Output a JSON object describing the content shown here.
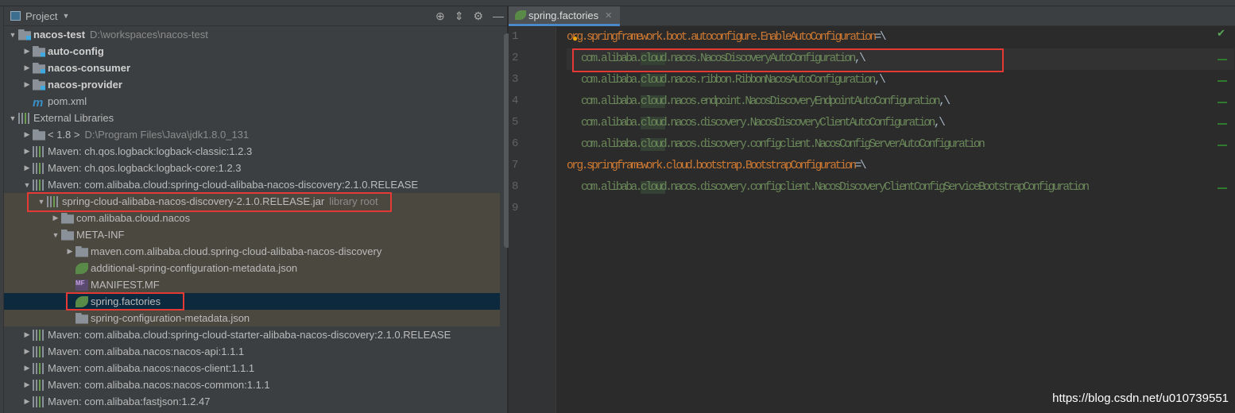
{
  "project_panel": {
    "title": "Project",
    "tree": [
      {
        "label": "nacos-test",
        "hint": "D:\\workspaces\\nacos-test",
        "depth": 0,
        "arrow": "down",
        "icon": "module-folder",
        "bold": true
      },
      {
        "label": "auto-config",
        "depth": 1,
        "arrow": "right",
        "icon": "module-folder",
        "bold": true
      },
      {
        "label": "nacos-consumer",
        "depth": 1,
        "arrow": "right",
        "icon": "module-folder",
        "bold": true
      },
      {
        "label": "nacos-provider",
        "depth": 1,
        "arrow": "right",
        "icon": "module-folder",
        "bold": true
      },
      {
        "label": "pom.xml",
        "depth": 1,
        "arrow": "",
        "icon": "maven-file"
      },
      {
        "label": "External Libraries",
        "depth": 0,
        "arrow": "down",
        "icon": "library"
      },
      {
        "label": "< 1.8 >",
        "hint": "D:\\Program Files\\Java\\jdk1.8.0_131",
        "depth": 1,
        "arrow": "right",
        "icon": "jdk-folder"
      },
      {
        "label": "Maven: ch.qos.logback:logback-classic:1.2.3",
        "depth": 1,
        "arrow": "right",
        "icon": "library"
      },
      {
        "label": "Maven: ch.qos.logback:logback-core:1.2.3",
        "depth": 1,
        "arrow": "right",
        "icon": "library"
      },
      {
        "label": "Maven: com.alibaba.cloud:spring-cloud-alibaba-nacos-discovery:2.1.0.RELEASE",
        "depth": 1,
        "arrow": "down",
        "icon": "library"
      },
      {
        "label": "spring-cloud-alibaba-nacos-discovery-2.1.0.RELEASE.jar",
        "hint": "library root",
        "depth": 2,
        "arrow": "down",
        "icon": "jar",
        "hl": true
      },
      {
        "label": "com.alibaba.cloud.nacos",
        "depth": 3,
        "arrow": "right",
        "icon": "package",
        "hl": true
      },
      {
        "label": "META-INF",
        "depth": 3,
        "arrow": "down",
        "icon": "package",
        "hl": true
      },
      {
        "label": "maven.com.alibaba.cloud.spring-cloud-alibaba-nacos-discovery",
        "depth": 4,
        "arrow": "right",
        "icon": "package",
        "hl": true
      },
      {
        "label": "additional-spring-configuration-metadata.json",
        "depth": 4,
        "arrow": "",
        "icon": "spring-json",
        "hl": true
      },
      {
        "label": "MANIFEST.MF",
        "depth": 4,
        "arrow": "",
        "icon": "manifest",
        "hl": true
      },
      {
        "label": "spring.factories",
        "depth": 4,
        "arrow": "",
        "icon": "spring-leaf",
        "selected": true
      },
      {
        "label": "spring-configuration-metadata.json",
        "depth": 4,
        "arrow": "",
        "icon": "json",
        "hl": true
      },
      {
        "label": "Maven: com.alibaba.cloud:spring-cloud-starter-alibaba-nacos-discovery:2.1.0.RELEASE",
        "depth": 1,
        "arrow": "right",
        "icon": "library"
      },
      {
        "label": "Maven: com.alibaba.nacos:nacos-api:1.1.1",
        "depth": 1,
        "arrow": "right",
        "icon": "library"
      },
      {
        "label": "Maven: com.alibaba.nacos:nacos-client:1.1.1",
        "depth": 1,
        "arrow": "right",
        "icon": "library"
      },
      {
        "label": "Maven: com.alibaba.nacos:nacos-common:1.1.1",
        "depth": 1,
        "arrow": "right",
        "icon": "library"
      },
      {
        "label": "Maven: com.alibaba:fastjson:1.2.47",
        "depth": 1,
        "arrow": "right",
        "icon": "library"
      }
    ]
  },
  "editor": {
    "tab": "spring.factories",
    "lines": [
      {
        "n": "1",
        "kind": "key",
        "text": "org.springframework.boot.autoconfigure.EnableAutoConfiguration",
        "suffix": "=\\"
      },
      {
        "n": "2",
        "kind": "value",
        "text": "com.alibaba.cloud.nacos.NacosDiscoveryAutoConfiguration",
        "suffix": ",\\"
      },
      {
        "n": "3",
        "kind": "value",
        "text": "com.alibaba.cloud.nacos.ribbon.RibbonNacosAutoConfiguration",
        "suffix": ",\\"
      },
      {
        "n": "4",
        "kind": "value",
        "text": "com.alibaba.cloud.nacos.endpoint.NacosDiscoveryEndpointAutoConfiguration",
        "suffix": ",\\"
      },
      {
        "n": "5",
        "kind": "value",
        "text": "com.alibaba.cloud.nacos.discovery.NacosDiscoveryClientAutoConfiguration",
        "suffix": ",\\"
      },
      {
        "n": "6",
        "kind": "value",
        "text": "com.alibaba.cloud.nacos.discovery.configclient.NacosConfigServerAutoConfiguration",
        "suffix": ""
      },
      {
        "n": "7",
        "kind": "key",
        "text": "org.springframework.cloud.bootstrap.BootstrapConfiguration",
        "suffix": "=\\"
      },
      {
        "n": "8",
        "kind": "value",
        "text": "com.alibaba.cloud.nacos.discovery.configclient.NacosDiscoveryClientConfigServiceBootstrapConfiguration",
        "suffix": ""
      },
      {
        "n": "9",
        "kind": "empty",
        "text": "",
        "suffix": ""
      }
    ]
  },
  "watermark": "https://blog.csdn.net/u010739551",
  "colors": {
    "key": "#cc7832",
    "value": "#6a8759",
    "highlight_box": "#e53935",
    "selection": "#0d293e"
  }
}
